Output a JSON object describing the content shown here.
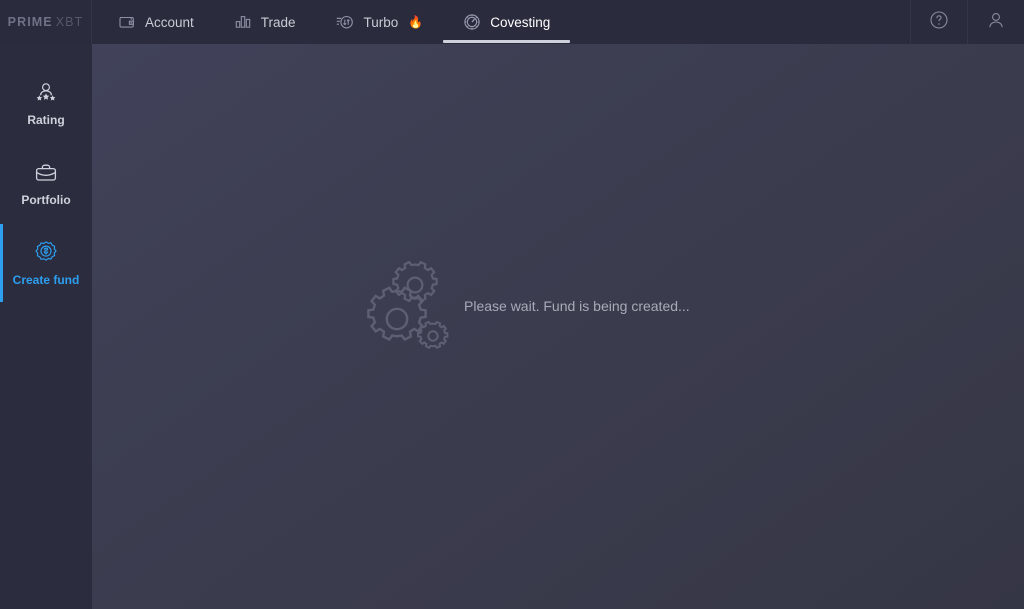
{
  "header": {
    "logo_prime": "PRIME",
    "logo_xbt": "XBT",
    "nav": [
      {
        "label": "Account",
        "icon": "wallet-icon",
        "active": false
      },
      {
        "label": "Trade",
        "icon": "bar-chart-icon",
        "active": false
      },
      {
        "label": "Turbo",
        "icon": "turbo-icon",
        "active": false,
        "badge": "🔥"
      },
      {
        "label": "Covesting",
        "icon": "gauge-icon",
        "active": true
      }
    ],
    "help_label": "?",
    "account_label": "Account menu"
  },
  "sidebar": {
    "items": [
      {
        "label": "Rating",
        "icon": "rating-star-person-icon",
        "active": false
      },
      {
        "label": "Portfolio",
        "icon": "briefcase-icon",
        "active": false
      },
      {
        "label": "Create fund",
        "icon": "fund-badge-icon",
        "active": true
      }
    ]
  },
  "main": {
    "loading_message": "Please wait. Fund is being created...",
    "loading_icon": "gears-icon"
  },
  "colors": {
    "header_bg": "#2a2b3c",
    "sidebar_bg": "#2b2c3e",
    "main_bg": "#3c3d50",
    "accent_blue": "#2e9ff0",
    "text_muted": "#a8aab8",
    "text_primary": "#ffffff",
    "gear_outline": "#5d5f73",
    "fire_orange": "#f05a28"
  }
}
